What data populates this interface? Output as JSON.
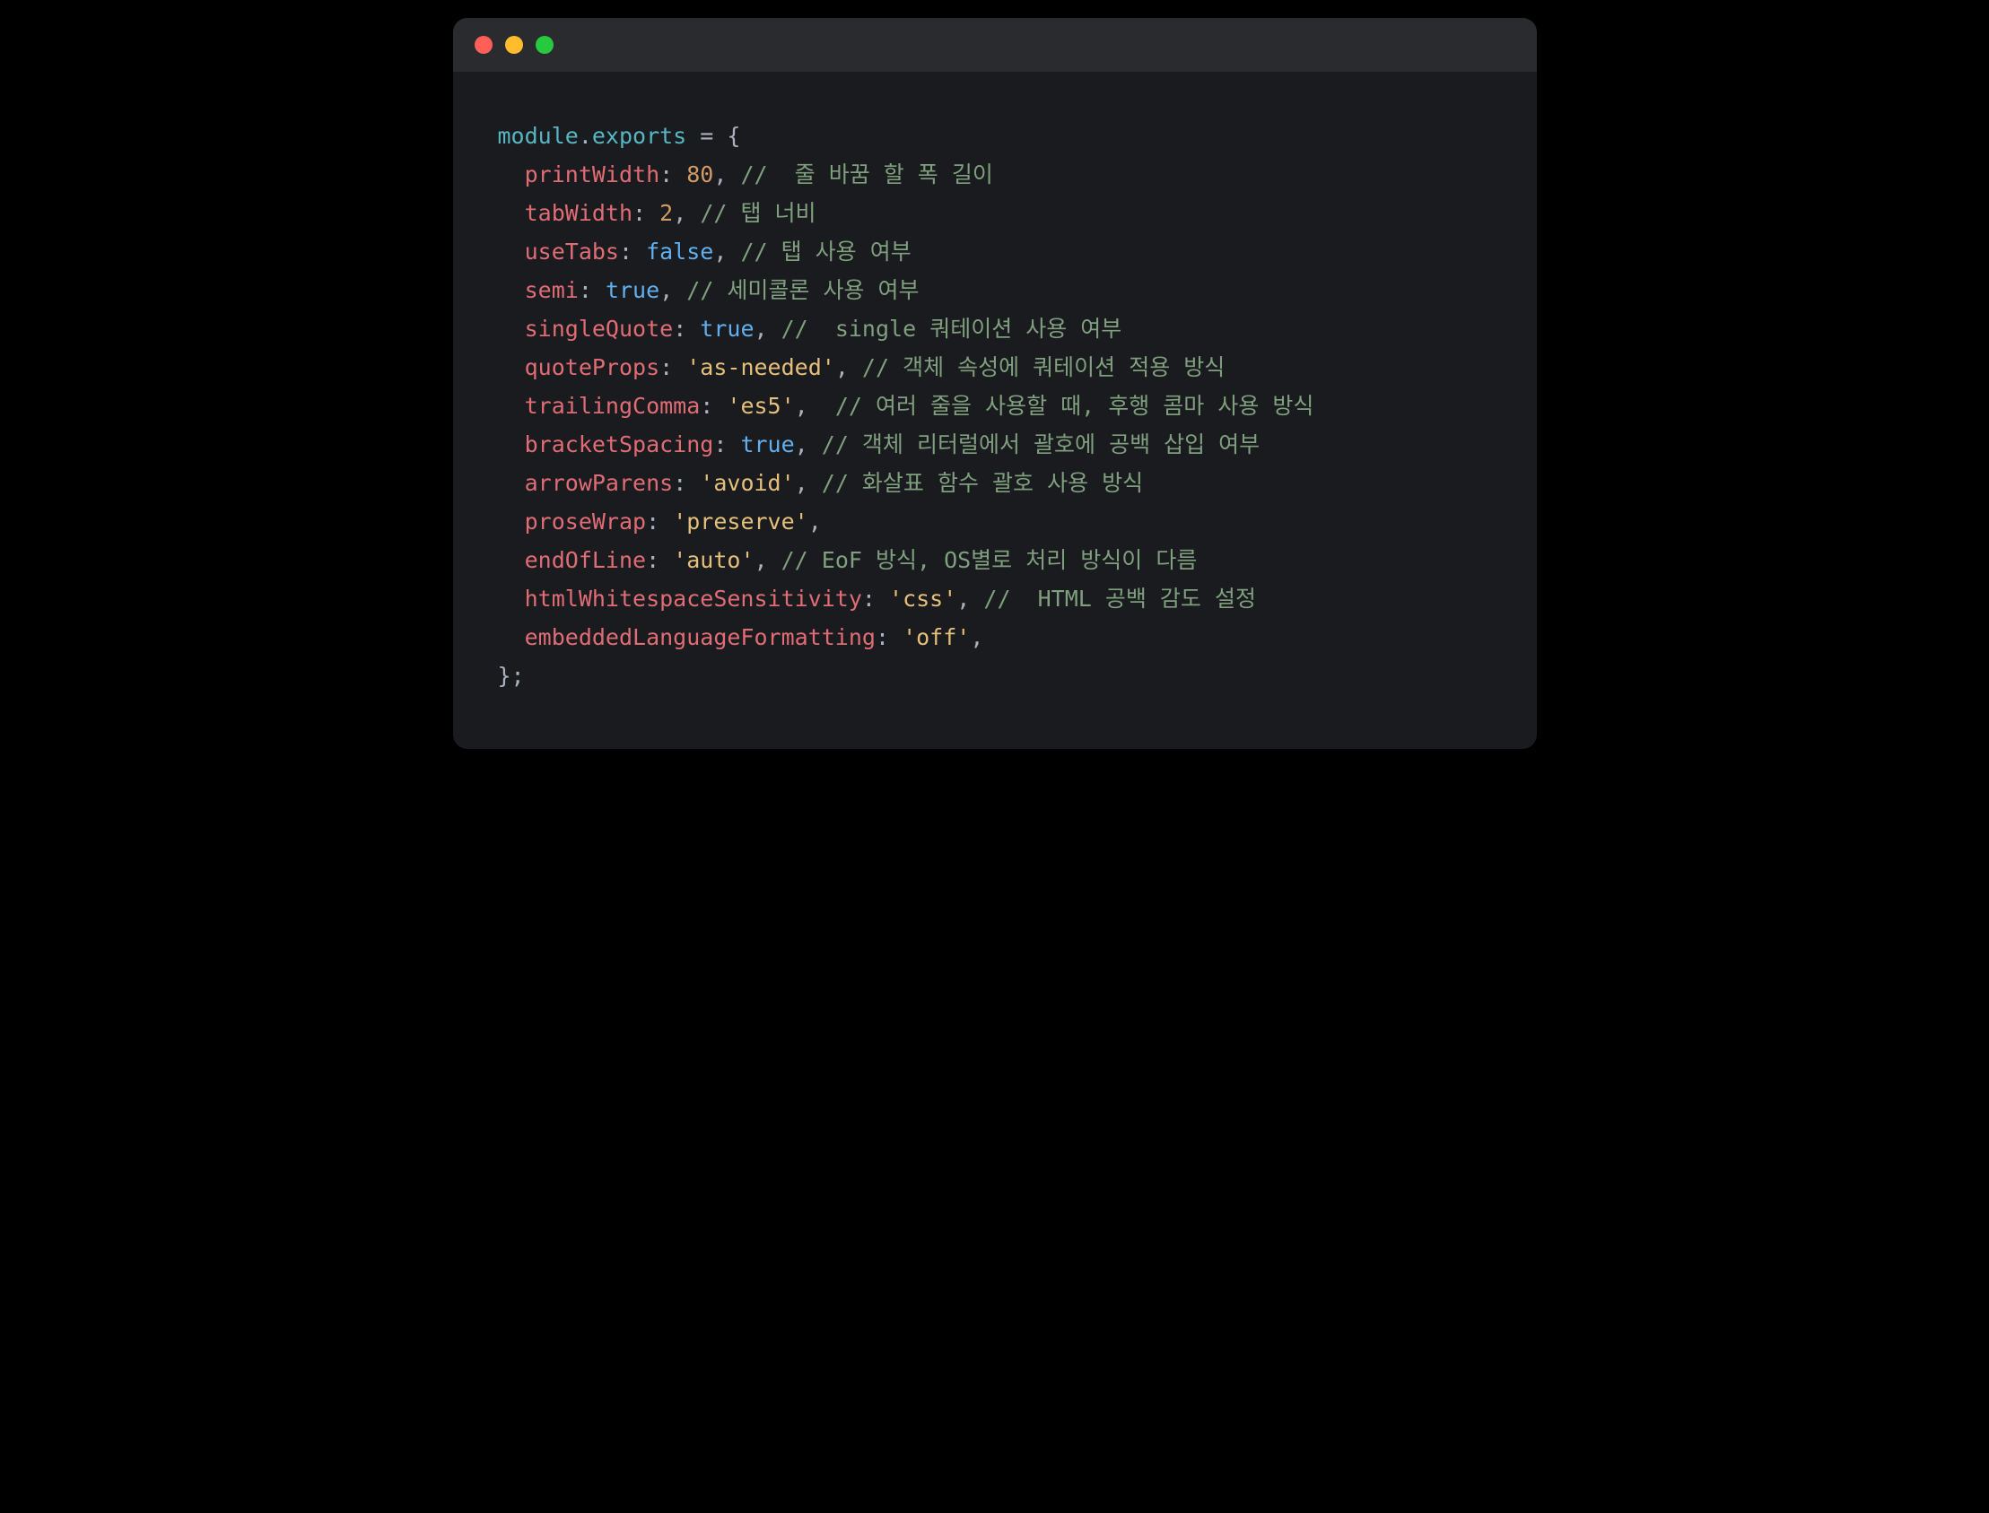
{
  "window": {
    "traffic_lights": [
      "close",
      "minimize",
      "zoom"
    ]
  },
  "code": {
    "moduleVar": "module",
    "exportsProp": "exports",
    "assign": " = ",
    "openBrace": "{",
    "closeBrace": "};",
    "indent": "  ",
    "lines": [
      {
        "prop": "printWidth",
        "colon": ": ",
        "valType": "number",
        "val": "80",
        "comma": ", ",
        "commentPrefix": "//  ",
        "comment": "줄 바꿈 할 폭 길이"
      },
      {
        "prop": "tabWidth",
        "colon": ": ",
        "valType": "number",
        "val": "2",
        "comma": ", ",
        "commentPrefix": "// ",
        "comment": "탭 너비"
      },
      {
        "prop": "useTabs",
        "colon": ": ",
        "valType": "boolean",
        "val": "false",
        "comma": ", ",
        "commentPrefix": "// ",
        "comment": "탭 사용 여부"
      },
      {
        "prop": "semi",
        "colon": ": ",
        "valType": "boolean",
        "val": "true",
        "comma": ", ",
        "commentPrefix": "// ",
        "comment": "세미콜론 사용 여부"
      },
      {
        "prop": "singleQuote",
        "colon": ": ",
        "valType": "boolean",
        "val": "true",
        "comma": ", ",
        "commentPrefix": "//  ",
        "comment": "single 쿼테이션 사용 여부"
      },
      {
        "prop": "quoteProps",
        "colon": ": ",
        "valType": "string",
        "val": "'as-needed'",
        "comma": ", ",
        "commentPrefix": "// ",
        "comment": "객체 속성에 쿼테이션 적용 방식"
      },
      {
        "prop": "trailingComma",
        "colon": ": ",
        "valType": "string",
        "val": "'es5'",
        "comma": ",  ",
        "commentPrefix": "// ",
        "comment": "여러 줄을 사용할 때, 후행 콤마 사용 방식"
      },
      {
        "prop": "bracketSpacing",
        "colon": ": ",
        "valType": "boolean",
        "val": "true",
        "comma": ", ",
        "commentPrefix": "// ",
        "comment": "객체 리터럴에서 괄호에 공백 삽입 여부"
      },
      {
        "prop": "arrowParens",
        "colon": ": ",
        "valType": "string",
        "val": "'avoid'",
        "comma": ", ",
        "commentPrefix": "// ",
        "comment": "화살표 함수 괄호 사용 방식"
      },
      {
        "prop": "proseWrap",
        "colon": ": ",
        "valType": "string",
        "val": "'preserve'",
        "comma": ",",
        "commentPrefix": "",
        "comment": ""
      },
      {
        "prop": "endOfLine",
        "colon": ": ",
        "valType": "string",
        "val": "'auto'",
        "comma": ", ",
        "commentPrefix": "// ",
        "comment": "EoF 방식, OS별로 처리 방식이 다름"
      },
      {
        "prop": "htmlWhitespaceSensitivity",
        "colon": ": ",
        "valType": "string",
        "val": "'css'",
        "comma": ", ",
        "commentPrefix": "//  ",
        "comment": "HTML 공백 감도 설정"
      },
      {
        "prop": "embeddedLanguageFormatting",
        "colon": ": ",
        "valType": "string",
        "val": "'off'",
        "comma": ",",
        "commentPrefix": "",
        "comment": ""
      }
    ]
  }
}
